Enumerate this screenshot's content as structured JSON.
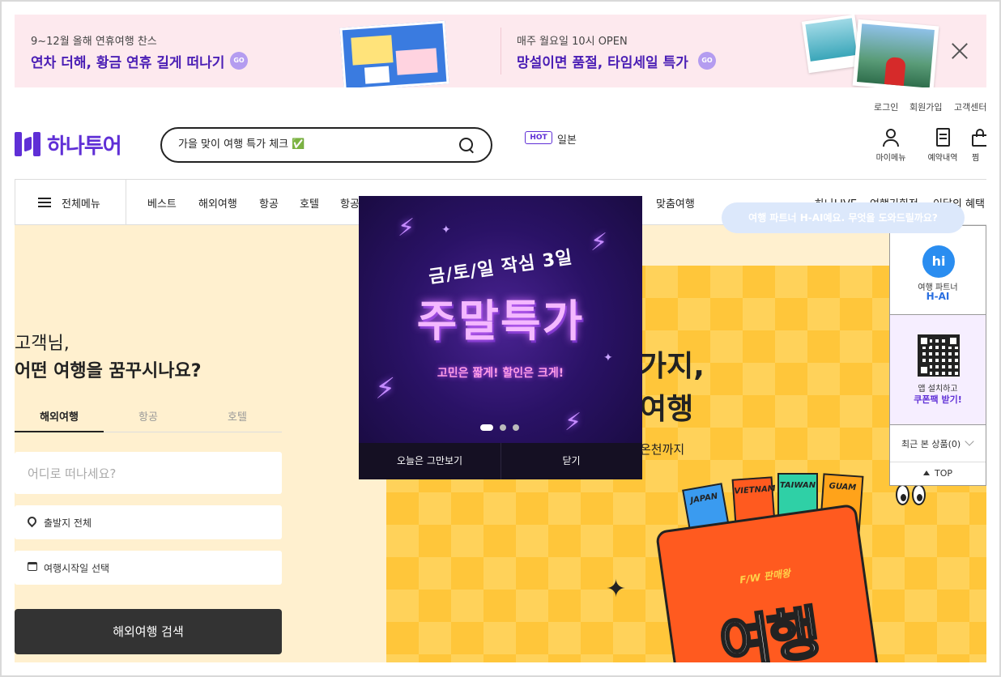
{
  "banner": {
    "left": {
      "sub": "9~12월 올해 연휴여행 찬스",
      "title": "연차 더해, 황금 연휴 길게 떠나기",
      "go": "GO"
    },
    "right": {
      "sub": "매주 월요일 10시 OPEN",
      "title": "망설이면 품절, 타임세일 특가",
      "go": "GO"
    }
  },
  "util_links": [
    "로그인",
    "회원가입",
    "고객센터"
  ],
  "logo": {
    "text": "하나투어"
  },
  "search": {
    "value": "가을 맞이 여행 특가 체크 ✅"
  },
  "hot": {
    "badge": "HOT",
    "keyword": "일본"
  },
  "header_icons": [
    {
      "name": "mypage",
      "label": "마이메뉴"
    },
    {
      "name": "reservation",
      "label": "예약내역"
    },
    {
      "name": "wishlist",
      "label": "찜"
    }
  ],
  "gnb": {
    "all_menu": "전체메뉴",
    "items": [
      "베스트",
      "해외여행",
      "항공",
      "호텔",
      "항공",
      "맞춤여행"
    ],
    "right_items": [
      "하나LIVE",
      "여행기획전",
      "이달의 혜택"
    ]
  },
  "hero": {
    "greeting": "고객님,",
    "question": "어떤 여행을 꿈꾸시나요?",
    "tabs": [
      "해외여행",
      "항공",
      "호텔"
    ],
    "active_tab": "해외여행",
    "destination_placeholder": "어디로 떠나세요?",
    "departure": "출발지 전체",
    "date": "여행시작일 선택",
    "search_button": "해외여행 검색",
    "main_title_a": "가지,",
    "main_title_b": "여행",
    "main_sub": "온천까지",
    "book_tag": "F/W 판매왕",
    "book_text": "여행",
    "flags": [
      "JAPAN",
      "VIETNAM",
      "TAIWAN",
      "GUAM"
    ]
  },
  "popup": {
    "top": "금/토/일 작심 3일",
    "big": "주말특가",
    "sub": "고민은 짧게! 할인은 크게!",
    "btn_today": "오늘은 그만보기",
    "btn_close": "닫기"
  },
  "ai": {
    "bubble": "여행 파트너 H-AI예요. 무엇을 도와드릴까요?",
    "label1": "여행 파트너",
    "label2": "H-AI",
    "icon_text": "hi"
  },
  "side": {
    "qr_label1": "앱 설치하고",
    "qr_label2": "쿠폰팩 받기!",
    "recent": "최근 본 상품(0)",
    "top": "TOP"
  },
  "colors": {
    "brand": "#5f2fd6",
    "banner_bg": "#fde9ee",
    "hero_bg": "#fff0cf"
  }
}
